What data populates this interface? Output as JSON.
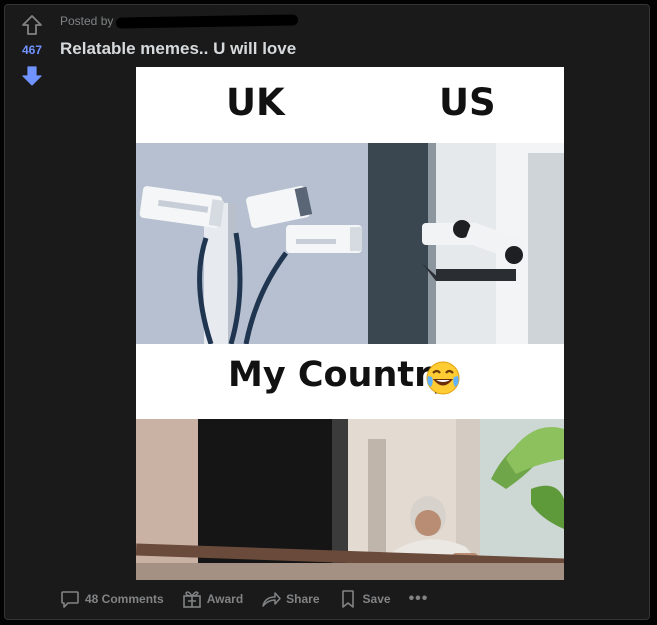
{
  "post": {
    "posted_by": "Posted by",
    "score": "467",
    "title": "Relatable memes.. U will love"
  },
  "meme": {
    "label_left": "UK",
    "label_right": "US",
    "label_bottom": "My Country",
    "emoji": "face-with-tears-of-joy"
  },
  "actions": {
    "comments": "48 Comments",
    "award": "Award",
    "share": "Share",
    "save": "Save",
    "more": "•••"
  },
  "colors": {
    "background": "#030303",
    "card": "#1a1a1b",
    "upvote_outline": "#818384",
    "downvote_active": "#7193ff",
    "muted_text": "#818384",
    "title_text": "#d7dadc"
  },
  "icons": [
    "upvote-icon",
    "downvote-icon",
    "comment-icon",
    "award-icon",
    "share-icon",
    "save-icon"
  ]
}
